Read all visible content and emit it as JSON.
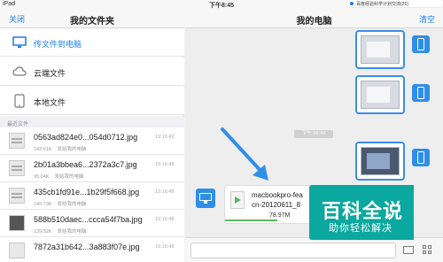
{
  "status_bar": {
    "device": "iPad",
    "time": "下午8:45"
  },
  "notification": {
    "text": "百度经验科学计划交流(25)"
  },
  "left_pane": {
    "nav": {
      "back_label": "关闭",
      "title": "我的文件夹"
    },
    "menu": [
      {
        "label": "传文件到电脑",
        "icon": "monitor-icon",
        "active": true
      },
      {
        "label": "云端文件",
        "icon": "cloud-icon",
        "active": false
      },
      {
        "label": "本地文件",
        "icon": "tablet-icon",
        "active": false
      }
    ],
    "section_title": "最近文件",
    "files": [
      {
        "name": "0563ad824e0...054d0712.jpg",
        "size": "142.61K",
        "source": "发给我的电脑",
        "time": "19:16:49"
      },
      {
        "name": "2b01a3bbea6...2372a3c7.jpg",
        "size": "95.04K",
        "source": "发给我的电脑",
        "time": "19:16:48"
      },
      {
        "name": "435cb1fd91e...1b29f5f668.jpg",
        "size": "140.73K",
        "source": "发给我的电脑",
        "time": "19:16:48"
      },
      {
        "name": "588b510daec...ccca54f7ba.jpg",
        "size": "139.52K",
        "source": "发给我的电脑",
        "time": "19:16:48"
      },
      {
        "name": "7872a31b642...3a883f07e.jpg",
        "size": "",
        "source": "",
        "time": "19:16:48"
      }
    ]
  },
  "right_pane": {
    "nav": {
      "title": "我的电脑",
      "clear_label": "清空"
    },
    "time_chip": "下午 08:44",
    "file_message": {
      "name_line1": "macbookpro-fea",
      "name_line2": "cn-20120611_8",
      "size": "78.97M",
      "progress": 0.6
    }
  },
  "watermark": {
    "title": "百科全说",
    "subtitle": "助你轻松解决"
  },
  "colors": {
    "accent": "#1a7cf0",
    "avatar": "#2f8fe8",
    "progress": "#5cb85c",
    "watermark": "#0aa89e"
  }
}
